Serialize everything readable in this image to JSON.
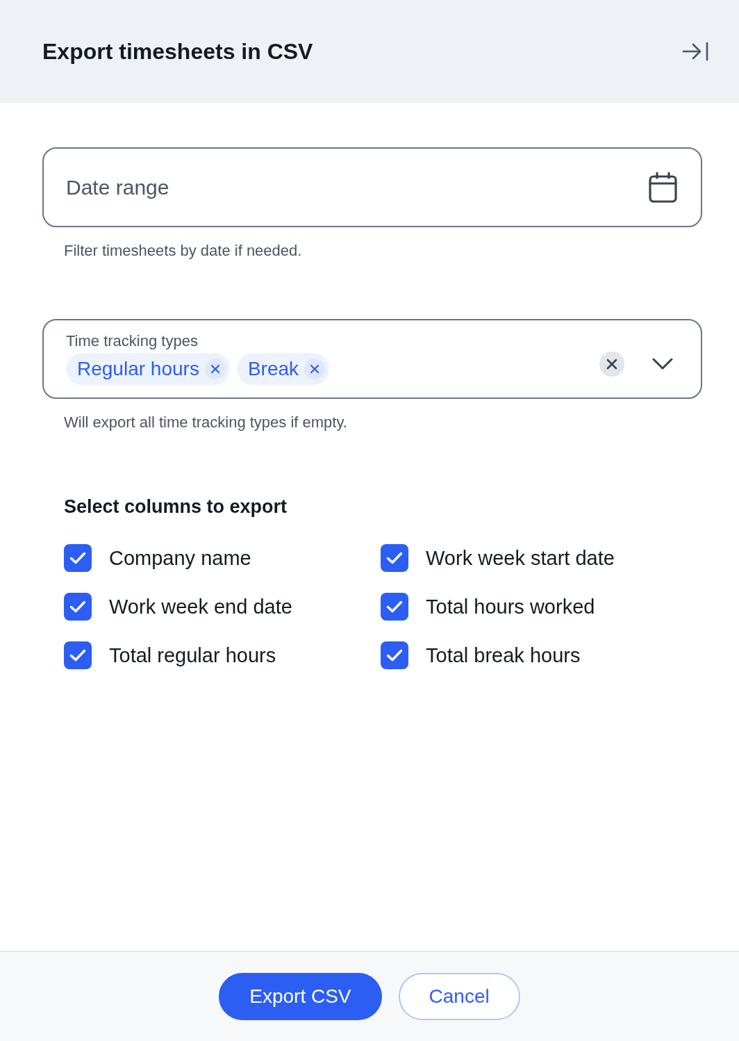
{
  "panel": {
    "title": "Export timesheets in CSV"
  },
  "date_range": {
    "placeholder": "Date range",
    "help": "Filter timesheets by date if needed."
  },
  "time_tracking_types": {
    "label": "Time tracking types",
    "chips": [
      {
        "label": "Regular hours"
      },
      {
        "label": "Break"
      }
    ],
    "help": "Will export all time tracking types if empty."
  },
  "columns": {
    "heading": "Select columns to export",
    "options": [
      {
        "label": "Company name",
        "checked": true
      },
      {
        "label": "Work week start date",
        "checked": true
      },
      {
        "label": "Work week end date",
        "checked": true
      },
      {
        "label": "Total hours worked",
        "checked": true
      },
      {
        "label": "Total regular hours",
        "checked": true
      },
      {
        "label": "Total break hours",
        "checked": true
      }
    ]
  },
  "buttons": [
    {
      "label": "Export CSV",
      "kind": "primary"
    },
    {
      "label": "Cancel",
      "kind": "secondary"
    }
  ]
}
